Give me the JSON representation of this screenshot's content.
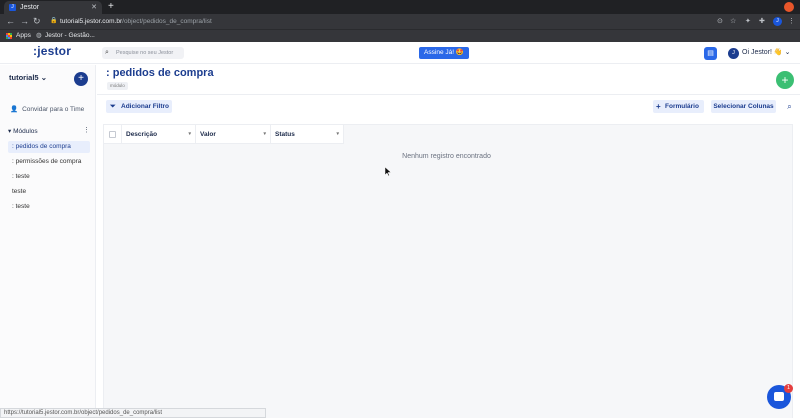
{
  "browser": {
    "tab_title": "Jestor",
    "tab_icon_letter": "J",
    "new_tab": "+",
    "url_host": "tutorial5.jestor.com.br",
    "url_path": "/object/pedidos_de_compra/list",
    "profile_letter": "J",
    "bookmarks": [
      "Apps",
      "Jestor - Gestão..."
    ],
    "status_url": "https://tutorial5.jestor.com.br/object/pedidos_de_compra/list"
  },
  "header": {
    "logo": ":jestor",
    "search_placeholder": "Pesquise no seu Jestor",
    "upgrade_label": "Assine Já! 🤩",
    "user_letter": "J",
    "greeting": "Oi Jestor! 👋"
  },
  "sidebar": {
    "workspace": "tutorial5",
    "invite_label": "Convidar para o Time",
    "modules_heading": "Módulos",
    "items": [
      {
        "label": ": pedidos de compra",
        "active": true
      },
      {
        "label": ": permissões de compra",
        "active": false
      },
      {
        "label": ": teste",
        "active": false
      },
      {
        "label": "teste",
        "active": false
      },
      {
        "label": ": teste",
        "active": false
      }
    ]
  },
  "main": {
    "title": ": pedidos de compra",
    "badge": "módulo",
    "add_filter_label": "Adicionar Filtro",
    "form_label": "Formulário",
    "select_columns_label": "Selecionar Colunas",
    "columns": [
      "Descrição",
      "Valor",
      "Status"
    ],
    "empty_message": "Nenhum registro encontrado"
  },
  "chat": {
    "badge_count": "1"
  },
  "colors": {
    "brand": "#1c3d8f",
    "accent": "#2a68e8",
    "fab": "#3bbf73"
  }
}
